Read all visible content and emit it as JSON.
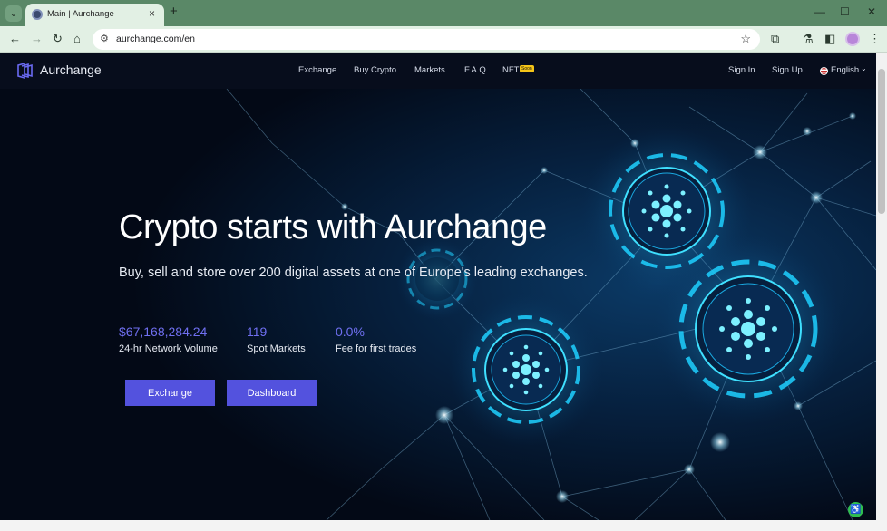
{
  "browser": {
    "tab_title": "Main | Aurchange",
    "tab_close": "×",
    "new_tab": "+",
    "url": "aurchange.com/en",
    "win_minimize": "—",
    "win_maximize": "☐",
    "win_close": "✕",
    "nav_back": "←",
    "nav_forward": "→",
    "nav_reload": "↻",
    "nav_home": "⌂",
    "icons": [
      "tab-search-icon",
      "back-arrow-icon",
      "forward-arrow-icon",
      "reload-icon",
      "home-icon",
      "site-info-icon",
      "star-icon",
      "extensions-icon",
      "labs-icon",
      "side-panel-icon",
      "profile-avatar",
      "kebab-menu-icon"
    ]
  },
  "site": {
    "brand": "Aurchange",
    "nav": {
      "links": [
        "Exchange",
        "Buy Crypto",
        "Markets",
        "F.A.Q.",
        "NFT"
      ],
      "soon_badge": "Soon",
      "sign_in": "Sign In",
      "sign_up": "Sign Up",
      "language": "English"
    },
    "hero": {
      "title": "Crypto starts with Aurchange",
      "subtitle": "Buy, sell and store over 200 digital assets at one of Europe's leading exchanges.",
      "stats": [
        {
          "value": "$67,168,284.24",
          "label": "24-hr Network Volume"
        },
        {
          "value": "119",
          "label": "Spot Markets"
        },
        {
          "value": "0.0%",
          "label": "Fee for first trades"
        }
      ],
      "buttons": {
        "exchange": "Exchange",
        "dashboard": "Dashboard"
      }
    }
  },
  "colors": {
    "accent": "#5352de",
    "stat_accent": "#6f6ff0",
    "chrome_green": "#5a8867",
    "page_bg": "#030916",
    "glow": "#22d3ee"
  }
}
